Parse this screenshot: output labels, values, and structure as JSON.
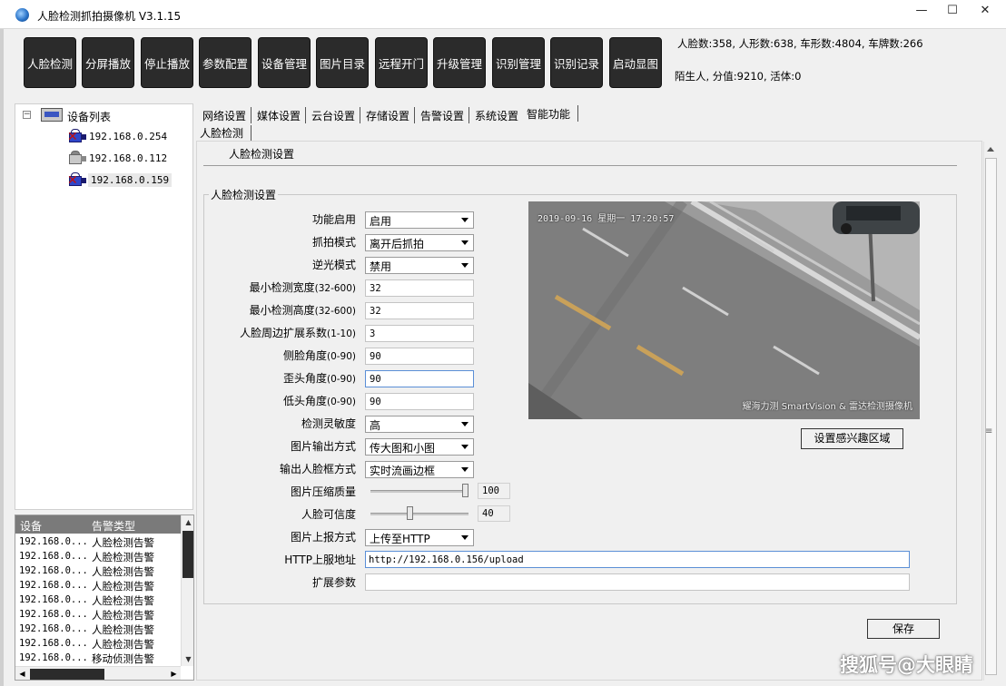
{
  "window": {
    "title": "人脸检测抓拍摄像机  V3.1.15",
    "min_glyph": "—",
    "max_glyph": "☐",
    "close_glyph": "✕"
  },
  "toolbar": {
    "buttons": [
      "人脸检测",
      "分屏播放",
      "停止播放",
      "参数配置",
      "设备管理",
      "图片目录",
      "远程开门",
      "升级管理",
      "识别管理",
      "识别记录",
      "启动显图"
    ]
  },
  "stats": {
    "line1": "人脸数:358, 人形数:638, 车形数:4804, 车牌数:266",
    "line2": "陌生人, 分值:9210, 活体:0"
  },
  "device_tree": {
    "root_label": "设备列表",
    "collapse_glyph": "−",
    "devices": [
      {
        "ip": "192.168.0.254",
        "status": "error"
      },
      {
        "ip": "192.168.0.112",
        "status": "offline"
      },
      {
        "ip": "192.168.0.159",
        "status": "error"
      }
    ]
  },
  "alarm_list": {
    "columns": [
      "设备",
      "告警类型"
    ],
    "rows": [
      {
        "device": "192.168.0...",
        "type": "人脸检测告警"
      },
      {
        "device": "192.168.0...",
        "type": "人脸检测告警"
      },
      {
        "device": "192.168.0...",
        "type": "人脸检测告警"
      },
      {
        "device": "192.168.0...",
        "type": "人脸检测告警"
      },
      {
        "device": "192.168.0...",
        "type": "人脸检测告警"
      },
      {
        "device": "192.168.0...",
        "type": "人脸检测告警"
      },
      {
        "device": "192.168.0...",
        "type": "人脸检测告警"
      },
      {
        "device": "192.168.0...",
        "type": "人脸检测告警"
      },
      {
        "device": "192.168.0...",
        "type": "移动侦测告警"
      }
    ]
  },
  "tabs": [
    "网络设置",
    "媒体设置",
    "云台设置",
    "存储设置",
    "告警设置",
    "系统设置",
    "智能功能"
  ],
  "active_tab": "智能功能",
  "subtab": "人脸检测",
  "section_title": "人脸检测设置",
  "group_title": "人脸检测设置",
  "form": {
    "enable": {
      "label": "功能启用",
      "value": "启用"
    },
    "capture_mode": {
      "label": "抓拍模式",
      "value": "离开后抓拍"
    },
    "backlight": {
      "label": "逆光模式",
      "value": "禁用"
    },
    "min_width": {
      "label": "最小检测宽度",
      "range": "(32-600)",
      "value": "32"
    },
    "min_height": {
      "label": "最小检测高度",
      "range": "(32-600)",
      "value": "32"
    },
    "expand": {
      "label": "人脸周边扩展系数",
      "range": "(1-10)",
      "value": "3"
    },
    "side_angle": {
      "label": "侧脸角度",
      "range": "(0-90)",
      "value": "90"
    },
    "tilt_angle": {
      "label": "歪头角度",
      "range": "(0-90)",
      "value": "90"
    },
    "down_angle": {
      "label": "低头角度",
      "range": "(0-90)",
      "value": "90"
    },
    "sensitivity": {
      "label": "检测灵敏度",
      "value": "高"
    },
    "pic_output": {
      "label": "图片输出方式",
      "value": "传大图和小图"
    },
    "box_output": {
      "label": "输出人脸框方式",
      "value": "实时流画边框"
    },
    "quality": {
      "label": "图片压缩质量",
      "value": "100",
      "level": 1.0
    },
    "confidence": {
      "label": "人脸可信度",
      "value": "40",
      "level": 0.4
    },
    "report_mode": {
      "label": "图片上报方式",
      "value": "上传至HTTP"
    },
    "http_url": {
      "label": "HTTP上服地址",
      "value": "http://192.168.0.156/upload"
    },
    "ext_params": {
      "label": "扩展参数",
      "value": ""
    }
  },
  "video": {
    "osd_time": "2019-09-16 星期一 17:20:57",
    "osd_brand": "耀海力测 SmartVision & 雷达检测摄像机"
  },
  "buttons": {
    "roi": "设置感兴趣区域",
    "save": "保存"
  },
  "watermark": "搜狐号@大眼睛"
}
